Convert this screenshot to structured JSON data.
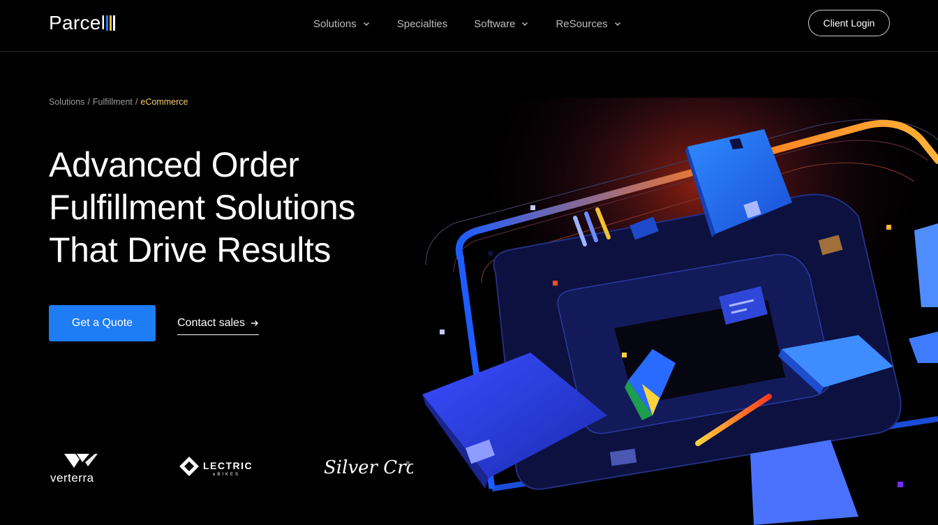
{
  "header": {
    "logo_text": "Parcel",
    "logo_bar_colors": [
      "#1e7cf5",
      "#f2c230",
      "#ffffff"
    ],
    "nav": [
      {
        "label": "Solutions",
        "has_dropdown": true
      },
      {
        "label": "Specialties",
        "has_dropdown": false
      },
      {
        "label": "Software",
        "has_dropdown": true
      },
      {
        "label": "ReSources",
        "has_dropdown": true
      }
    ],
    "login_label": "Client Login"
  },
  "breadcrumb": {
    "items": [
      "Solutions",
      "Fulfillment"
    ],
    "separator": "/",
    "current": "eCommerce"
  },
  "hero": {
    "title_lines": [
      "Advanced Order",
      "Fulfillment Solutions",
      "That Drive Results"
    ],
    "primary_cta": "Get a Quote",
    "secondary_cta": "Contact sales"
  },
  "partners": [
    {
      "name": "verterra",
      "icon": "verterra-logo"
    },
    {
      "name": "LECTRIC",
      "sub": "eBIKES",
      "icon": "lectric-logo"
    },
    {
      "name": "Silver Cross",
      "icon": "silver-cross-logo"
    }
  ],
  "colors": {
    "accent_blue": "#1e7cf5",
    "breadcrumb_current": "#f2d16b",
    "background": "#000000"
  }
}
